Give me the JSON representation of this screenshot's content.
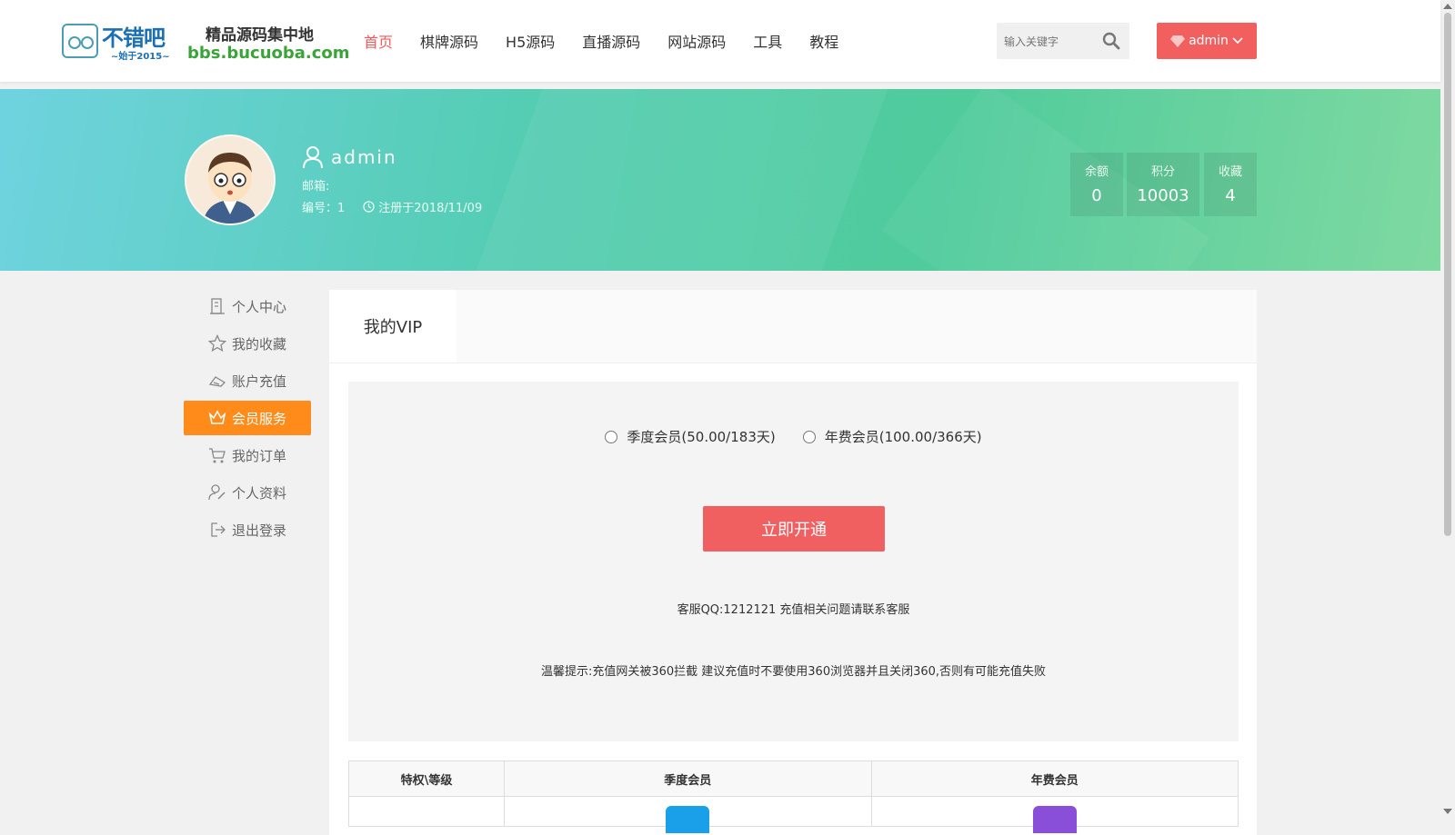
{
  "header": {
    "logo_cn": "不错吧",
    "logo_since": "~始于2015~",
    "logo_tagline": "精品源码集中地",
    "logo_url": "bbs.bucuoba.com",
    "nav": [
      "首页",
      "棋牌源码",
      "H5源码",
      "直播源码",
      "网站源码",
      "工具",
      "教程"
    ],
    "search_placeholder": "输入关键字",
    "user_button": "admin"
  },
  "profile": {
    "username": "admin",
    "email_label": "邮箱:",
    "id_label": "编号：1",
    "registered": "注册于2018/11/09",
    "stats": [
      {
        "label": "余额",
        "value": "0"
      },
      {
        "label": "积分",
        "value": "10003"
      },
      {
        "label": "收藏",
        "value": "4"
      }
    ]
  },
  "sidebar": {
    "items": [
      "个人中心",
      "我的收藏",
      "账户充值",
      "会员服务",
      "我的订单",
      "个人资料",
      "退出登录"
    ]
  },
  "main": {
    "tab": "我的VIP",
    "options": [
      "季度会员(50.00/183天)",
      "年费会员(100.00/366天)"
    ],
    "open_button": "立即开通",
    "qq_text": "客服QQ:1212121 充值相关问题请联系客服",
    "tip_text": "温馨提示:充值网关被360拦截 建议充值时不要使用360浏览器并且关闭360,否则有可能充值失败",
    "table_headers": [
      "特权\\等级",
      "季度会员",
      "年费会员"
    ]
  },
  "colors": {
    "accent_red": "#f25f5f",
    "active_orange": "#ff8b1a",
    "brand_green": "#3aa33a",
    "brand_blue": "#1a6fb5"
  }
}
